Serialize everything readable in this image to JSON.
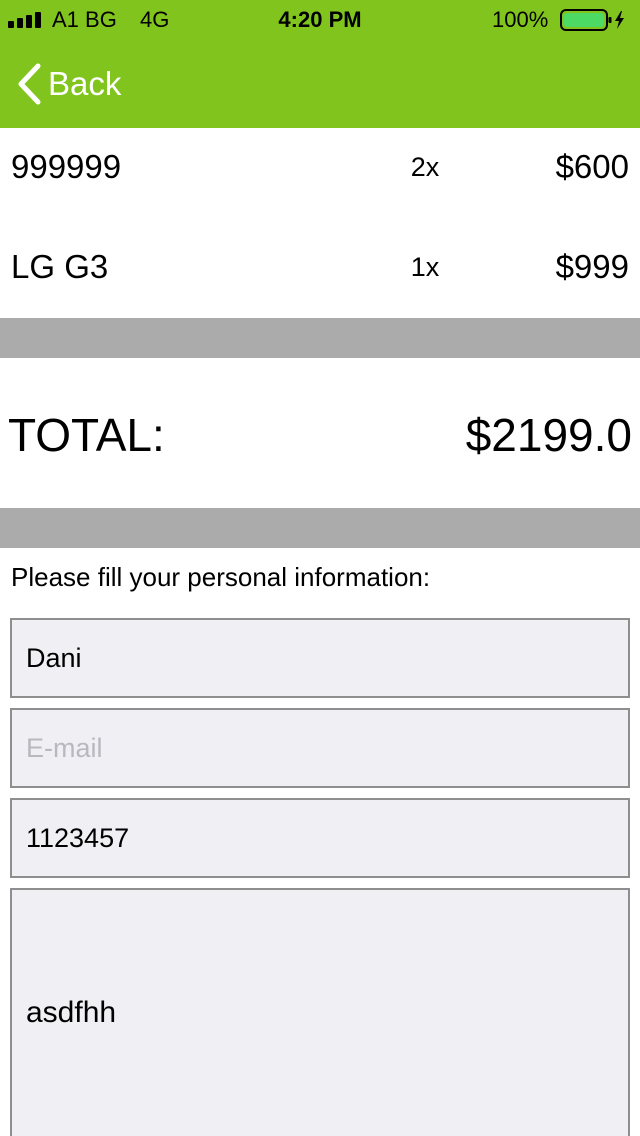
{
  "status_bar": {
    "carrier": "A1 BG",
    "network": "4G",
    "time": "4:20 PM",
    "battery_percent": "100%",
    "battery_color": "#4cd964"
  },
  "header": {
    "background_color": "#82c41e",
    "back_label": "Back",
    "back_icon": "chevron-left-icon"
  },
  "cart": {
    "items": [
      {
        "name": "999999",
        "quantity": "2x",
        "price": "$600"
      },
      {
        "name": "LG G3",
        "quantity": "1x",
        "price": "$999"
      }
    ],
    "total_label": "TOTAL:",
    "total_value": "$2199.0"
  },
  "form": {
    "prompt": "Please fill your personal information:",
    "name_value": "Dani",
    "email_value": "",
    "email_placeholder": "E-mail",
    "phone_value": "1123457",
    "address_value": "asdfhh"
  }
}
